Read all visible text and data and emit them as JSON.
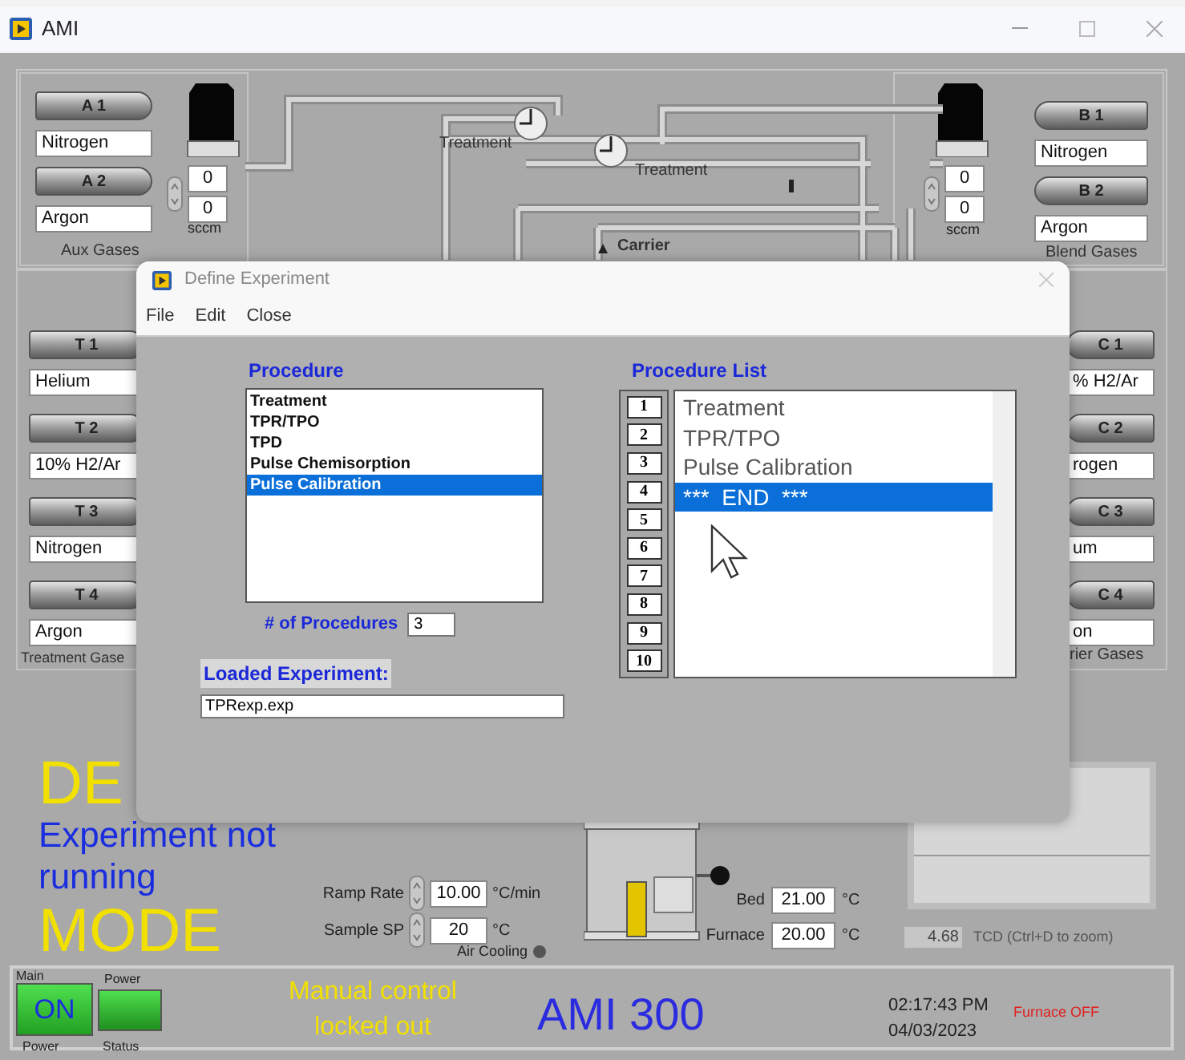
{
  "window": {
    "title": "AMI"
  },
  "aux_gases": {
    "label": "Aux Gases",
    "unit": "sccm",
    "flows": [
      "0",
      "0"
    ],
    "cylinders": [
      {
        "name": "A 1",
        "gas": "Nitrogen"
      },
      {
        "name": "A 2",
        "gas": "Argon"
      }
    ]
  },
  "blend_gases": {
    "label": "Blend Gases",
    "unit": "sccm",
    "flows": [
      "0",
      "0"
    ],
    "cylinders": [
      {
        "name": "B 1",
        "gas": "Nitrogen"
      },
      {
        "name": "B 2",
        "gas": "Argon"
      }
    ]
  },
  "flow_path_labels": [
    "Treatment",
    "Treatment",
    "Carrier"
  ],
  "treatment_gases": {
    "label": "Treatment Gase",
    "cylinders": [
      {
        "name": "T 1",
        "gas": "Helium"
      },
      {
        "name": "T 2",
        "gas": "10% H2/Ar"
      },
      {
        "name": "T 3",
        "gas": "Nitrogen"
      },
      {
        "name": "T 4",
        "gas": "Argon"
      }
    ]
  },
  "carrier_gases": {
    "label": "rier Gases",
    "cylinders": [
      {
        "name": "C 1",
        "gas": "% H2/Ar"
      },
      {
        "name": "C 2",
        "gas": "rogen"
      },
      {
        "name": "C 3",
        "gas": "um"
      },
      {
        "name": "C 4",
        "gas": "on"
      }
    ]
  },
  "dialog": {
    "title": "Define Experiment",
    "menu": [
      "File",
      "Edit",
      "Close"
    ],
    "procedure": {
      "label": "Procedure",
      "items": [
        {
          "text": "Treatment",
          "selected": false
        },
        {
          "text": "TPR/TPO",
          "selected": false
        },
        {
          "text": "TPD",
          "selected": false
        },
        {
          "text": "Pulse Chemisorption",
          "selected": false
        },
        {
          "text": "Pulse Calibration",
          "selected": true
        }
      ]
    },
    "count_label": "# of Procedures",
    "count": "3",
    "loaded_label": "Loaded Experiment:",
    "loaded_file": "TPRexp.exp",
    "procedure_list": {
      "label": "Procedure List",
      "numbers": [
        "1",
        "2",
        "3",
        "4",
        "5",
        "6",
        "7",
        "8",
        "9",
        "10"
      ],
      "items": [
        {
          "text": "Treatment",
          "selected": false
        },
        {
          "text": "TPR/TPO",
          "selected": false
        },
        {
          "text": "Pulse Calibration",
          "selected": false
        },
        {
          "text": "***  END  ***",
          "selected": true
        }
      ]
    }
  },
  "mode_banner": [
    "DE",
    "MODE"
  ],
  "experiment_status": "Experiment not running",
  "ramp_rate": {
    "label": "Ramp Rate",
    "value": "10.00",
    "unit": "°C/min"
  },
  "sample_sp": {
    "label": "Sample SP",
    "value": "20",
    "unit": "°C"
  },
  "air_cooling": "Air Cooling",
  "temperatures": [
    {
      "label": "Bed",
      "value": "21.00",
      "unit": "°C"
    },
    {
      "label": "Furnace",
      "value": "20.00",
      "unit": "°C"
    }
  ],
  "tcd": {
    "value": "4.68",
    "label": "TCD (Ctrl+D to zoom)"
  },
  "status_bar": {
    "main_label": "Main",
    "power_button": {
      "text": "ON",
      "on": true
    },
    "power_label": "Power",
    "status_top_label": "Power",
    "status_label": "Status",
    "status_on": true,
    "message": "Manual control locked out",
    "product": "AMI 300",
    "time": "02:17:43 PM",
    "date": "04/03/2023",
    "furnace": "Furnace OFF"
  }
}
